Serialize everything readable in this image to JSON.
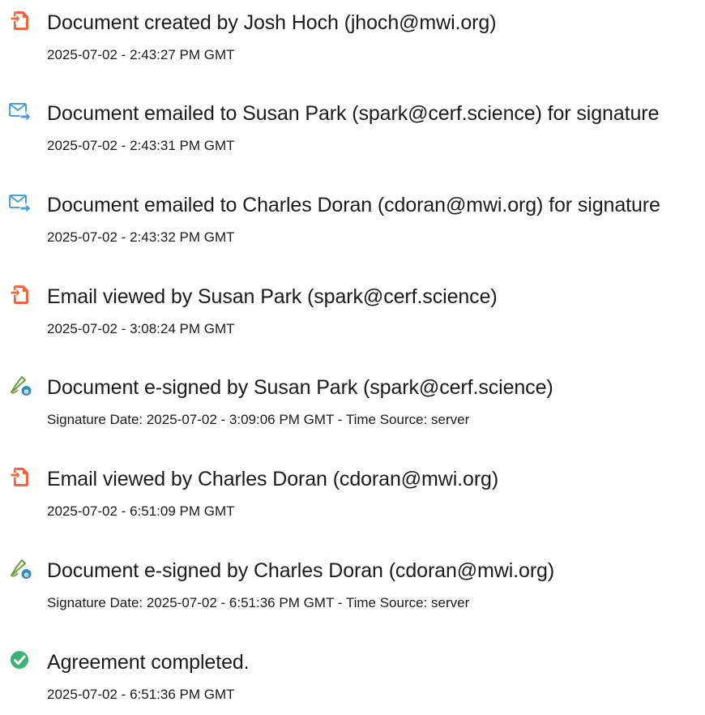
{
  "events": [
    {
      "icon": "document-icon",
      "title": "Document created by Josh Hoch (jhoch@mwi.org)",
      "time": "2025-07-02 - 2:43:27 PM GMT"
    },
    {
      "icon": "email-sent-icon",
      "title": "Document emailed to Susan Park (spark@cerf.science) for signature",
      "time": "2025-07-02 - 2:43:31 PM GMT"
    },
    {
      "icon": "email-sent-icon",
      "title": "Document emailed to Charles Doran (cdoran@mwi.org) for signature",
      "time": "2025-07-02 - 2:43:32 PM GMT"
    },
    {
      "icon": "document-icon",
      "title": "Email viewed by Susan Park (spark@cerf.science)",
      "time": "2025-07-02 - 3:08:24 PM GMT"
    },
    {
      "icon": "e-sign-pen-icon",
      "title": "Document e-signed by Susan Park (spark@cerf.science)",
      "time": "Signature Date: 2025-07-02 - 3:09:06 PM GMT - Time Source: server"
    },
    {
      "icon": "document-icon",
      "title": "Email viewed by Charles Doran (cdoran@mwi.org)",
      "time": "2025-07-02 - 6:51:09 PM GMT"
    },
    {
      "icon": "e-sign-pen-icon",
      "title": "Document e-signed by Charles Doran (cdoran@mwi.org)",
      "time": "Signature Date: 2025-07-02 - 6:51:36 PM GMT - Time Source: server"
    },
    {
      "icon": "check-circle-icon",
      "title": "Agreement completed.",
      "time": "2025-07-02 - 6:51:36 PM GMT"
    }
  ],
  "colors": {
    "document_icon": "#f0663d",
    "email_icon": "#4a9fdc",
    "sign_icon": "#6aa13a",
    "check_icon": "#3bb273"
  }
}
